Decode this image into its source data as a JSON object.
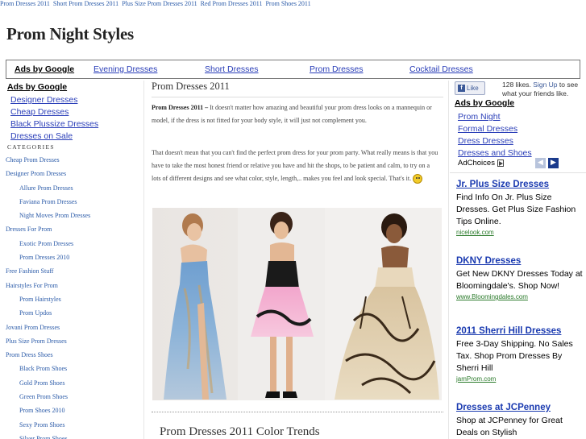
{
  "topbar": {
    "links": [
      "Prom Dresses 2011",
      "Short Prom Dresses 2011",
      "Plus Size Prom Dresses 2011",
      "Red Prom Dresses 2011",
      "Prom Shoes 2011"
    ]
  },
  "site": {
    "title": "Prom Night Styles"
  },
  "adbar": {
    "ads_by": "Ads by Google",
    "links": [
      "Evening Dresses",
      "Short Dresses",
      "Prom Dresses",
      "Cocktail Dresses"
    ]
  },
  "left": {
    "ads_by": "Ads by Google",
    "ad_links": [
      "Designer Dresses",
      "Cheap Dresses",
      "Black Plussize Dresses",
      "Dresses on Sale"
    ],
    "categories_heading": "CATEGORIES",
    "categories": [
      {
        "label": "Cheap Prom Dresses",
        "sub": false
      },
      {
        "label": "Designer Prom Dresses",
        "sub": false
      },
      {
        "label": "Allure Prom Dresses",
        "sub": true
      },
      {
        "label": "Faviana Prom Dresses",
        "sub": true
      },
      {
        "label": "Night Moves Prom Dresses",
        "sub": true
      },
      {
        "label": "Dresses For Prom",
        "sub": false
      },
      {
        "label": "Exotic Prom Dresses",
        "sub": true
      },
      {
        "label": "Prom Dresses 2010",
        "sub": true
      },
      {
        "label": "Free Fashion Stuff",
        "sub": false
      },
      {
        "label": "Hairstyles For Prom",
        "sub": false
      },
      {
        "label": "Prom Hairstyles",
        "sub": true
      },
      {
        "label": "Prom Updos",
        "sub": true
      },
      {
        "label": "Jovani Prom Dresses",
        "sub": false
      },
      {
        "label": "Plus Size Prom Dresses",
        "sub": false
      },
      {
        "label": "Prom Dress Shoes",
        "sub": false
      },
      {
        "label": "Black Prom Shoes",
        "sub": true
      },
      {
        "label": "Gold Prom Shoes",
        "sub": true
      },
      {
        "label": "Green Prom Shoes",
        "sub": true
      },
      {
        "label": "Prom Shoes 2010",
        "sub": true
      },
      {
        "label": "Sexy Prom Shoes",
        "sub": true
      },
      {
        "label": "Silver Prom Shoes",
        "sub": true
      }
    ]
  },
  "post": {
    "title": "Prom Dresses 2011",
    "lead_bold": "Prom Dresses 2011 –",
    "lead_text": " It doesn't matter how amazing and beautiful your prom dress looks on a mannequin or model, if the dress is not fitted for your body style, it will just not complement you.",
    "para2": "That doesn't mean that you can't find the perfect prom dress for your prom party. What really means is that you have to take the most honest friend or relative you have and hit the shops, to be patient and calm, to try on a lots of different designs and see what color, style, length,.. makes you feel and look special. That's it.",
    "subheading": "Prom Dresses 2011 Color Trends"
  },
  "right": {
    "like_label": "Like",
    "like_count_text": "128 likes.",
    "signup": "Sign Up",
    "like_suffix": " to see what your friends like.",
    "ads_by": "Ads by Google",
    "links": [
      "Prom Night",
      "Formal Dresses",
      "Dress Dresses",
      "Dresses and Shoes"
    ],
    "adchoices": "AdChoices",
    "ads": [
      {
        "title": "Jr. Plus Size Dresses",
        "desc": "Find Info On Jr. Plus Size Dresses. Get Plus Size Fashion Tips Online.",
        "url": "nicelook.com"
      },
      {
        "title": "DKNY Dresses",
        "desc": "Get New DKNY Dresses Today at Bloomingdale's. Shop Now!",
        "url": "www.Bloomingdales.com"
      },
      {
        "title": "2011 Sherri Hill Dresses",
        "desc": "Free 3-Day Shipping. No Sales Tax. Shop Prom Dresses By Sherri Hill",
        "url": "jamProm.com"
      },
      {
        "title": "Dresses at JCPenney",
        "desc": "Shop at JCPenney for Great Deals on Stylish",
        "url": ""
      }
    ]
  },
  "colors": {
    "link": "#2a5aa8",
    "ad_link": "#2a3eb8",
    "ad_url": "#2a7a2a",
    "facebook": "#3b5998"
  }
}
